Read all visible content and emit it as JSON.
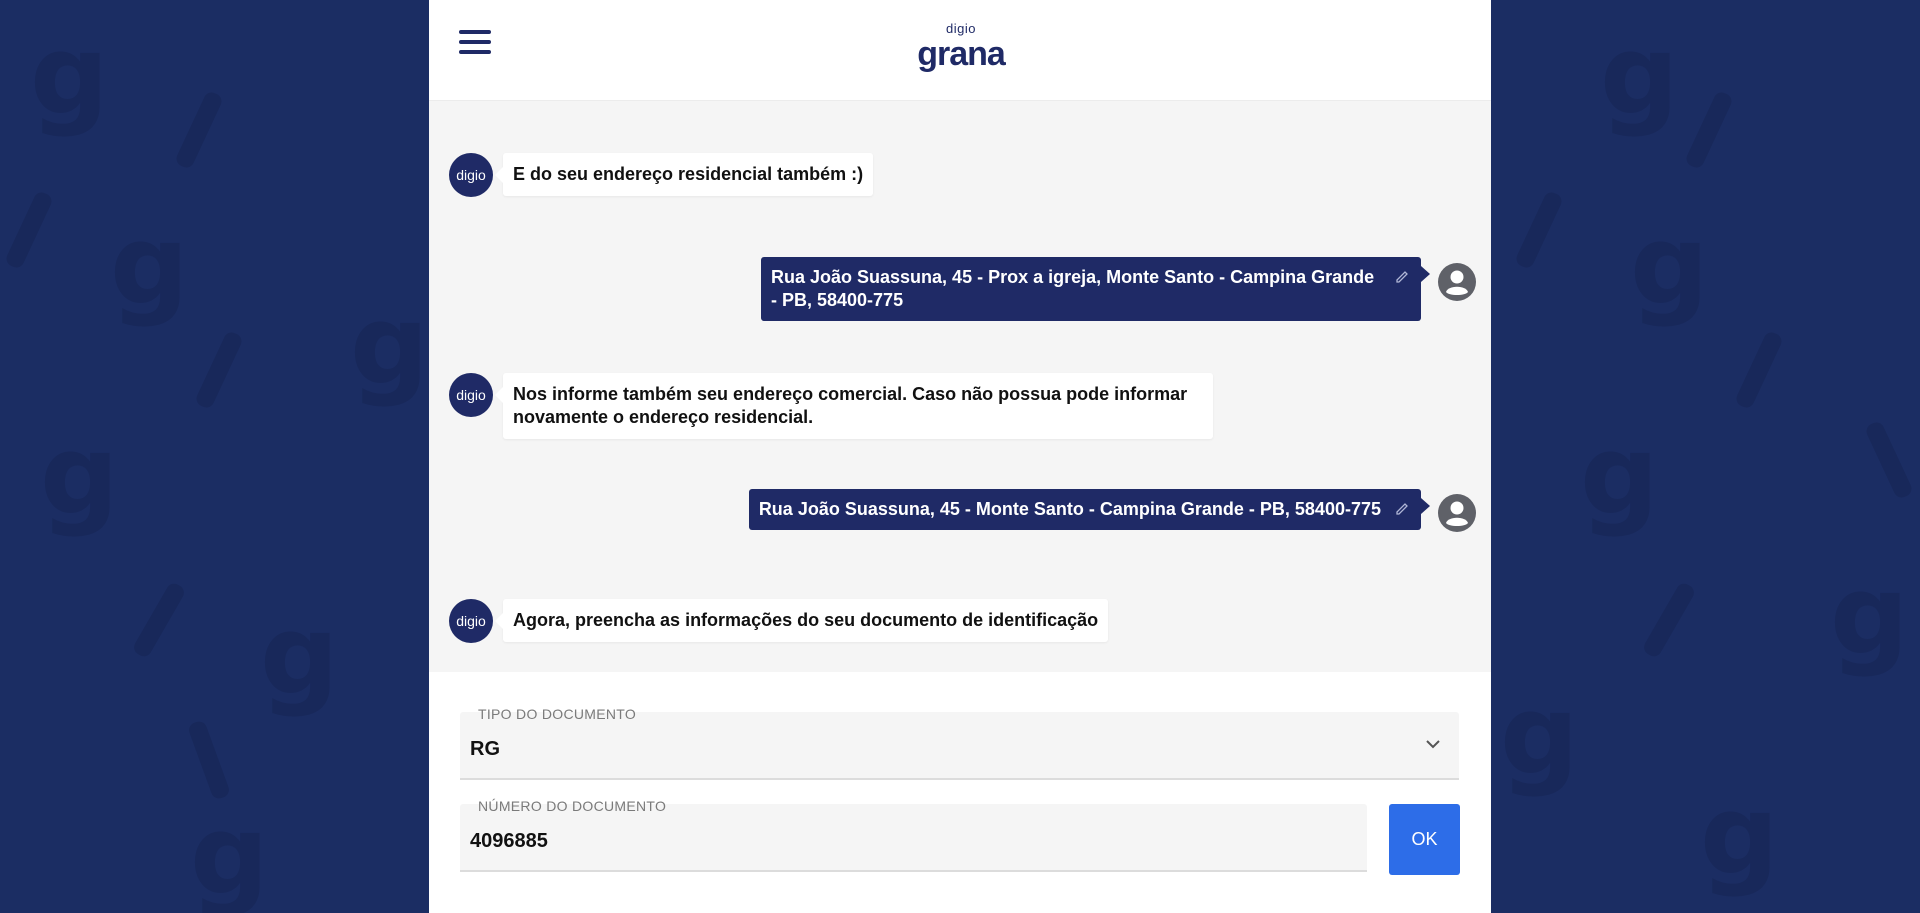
{
  "header": {
    "logo_small": "digio",
    "logo_big": "grana"
  },
  "messages": [
    {
      "from": "bot",
      "avatar": "digio",
      "text": "E do seu endereço residencial também :)"
    },
    {
      "from": "user",
      "text": "Rua João Suassuna, 45 - Prox a igreja, Monte Santo - Campina Grande - PB, 58400-775"
    },
    {
      "from": "bot",
      "avatar": "digio",
      "text": "Nos informe também seu endereço comercial. Caso não possua pode informar novamente o endereço residencial."
    },
    {
      "from": "user",
      "text": "Rua João Suassuna, 45 - Monte Santo - Campina Grande - PB, 58400-775"
    },
    {
      "from": "bot",
      "avatar": "digio",
      "text": "Agora, preencha as informações do seu documento de identificação"
    }
  ],
  "form": {
    "doc_type_label": "TIPO DO DOCUMENTO",
    "doc_type_value": "RG",
    "doc_number_label": "NÚMERO DO DOCUMENTO",
    "doc_number_value": "4096885",
    "ok_label": "OK"
  },
  "colors": {
    "brand_navy": "#1f2a66",
    "background": "#1b2d63",
    "ok_button": "#2d6de8"
  },
  "icons": [
    "menu-icon",
    "edit-icon",
    "user-avatar-icon",
    "chevron-down-icon"
  ]
}
